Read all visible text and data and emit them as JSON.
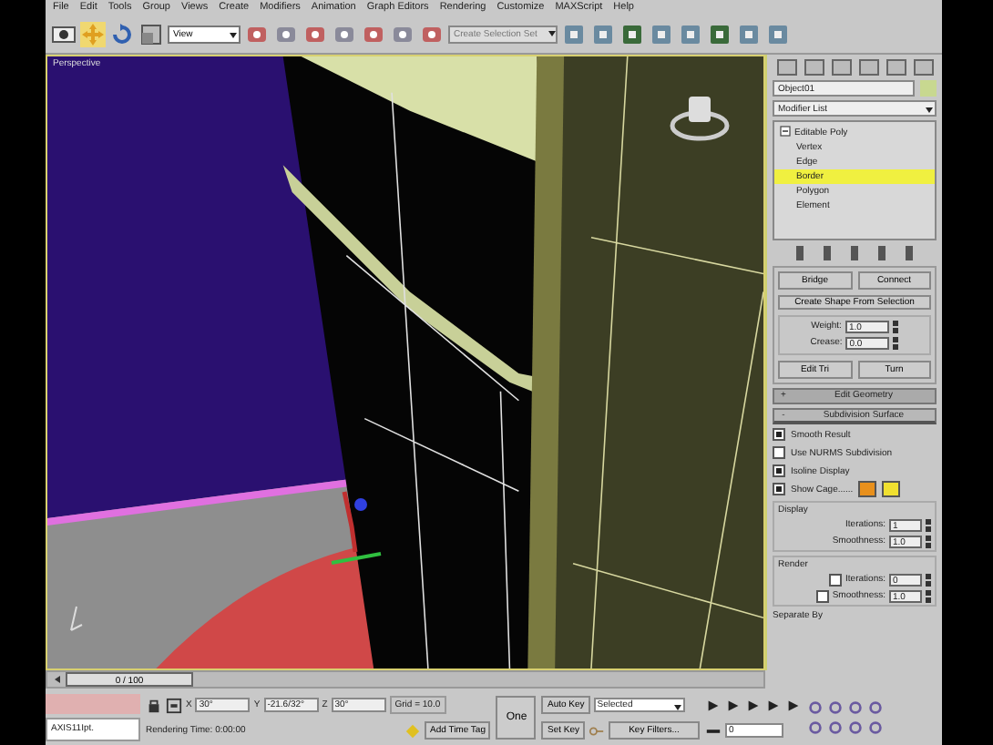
{
  "menu": [
    "File",
    "Edit",
    "Tools",
    "Group",
    "Views",
    "Create",
    "Modifiers",
    "Animation",
    "Graph Editors",
    "Rendering",
    "Customize",
    "MAXScript",
    "Help"
  ],
  "toolbar": {
    "view_dropdown": "View",
    "selection_set": {
      "placeholder": "Create Selection Set"
    }
  },
  "viewport": {
    "label": "Perspective"
  },
  "command_panel": {
    "object_name": "Object01",
    "modifier_list": "Modifier List",
    "stack": [
      {
        "label": "Editable Poly",
        "expanded": true,
        "selected": false,
        "children": [
          {
            "label": "Vertex",
            "selected": false
          },
          {
            "label": "Edge",
            "selected": false
          },
          {
            "label": "Border",
            "selected": true
          },
          {
            "label": "Polygon",
            "selected": false
          },
          {
            "label": "Element",
            "selected": false
          }
        ]
      }
    ],
    "top_buttons": [
      "Bridge",
      "Connect"
    ],
    "create_shape_button": "Create Shape From Selection",
    "spinners": [
      {
        "label": "Weight:",
        "value": "1.0"
      },
      {
        "label": "Crease:",
        "value": "0.0"
      }
    ],
    "edit_buttons": [
      "Edit Tri",
      "Turn"
    ],
    "rollouts": [
      {
        "sign": "+",
        "title": "Edit Geometry",
        "expanded": false
      },
      {
        "sign": "-",
        "title": "Subdivision Surface",
        "expanded": true
      }
    ],
    "options": [
      {
        "label": "Smooth Result",
        "checked": true
      },
      {
        "label": "Use NURMS Subdivision",
        "checked": false
      },
      {
        "label": "Isoline Display",
        "checked": true
      },
      {
        "label": "Show Cage......",
        "checked": true
      }
    ],
    "cage_colors": [
      {
        "color": "#e8901c"
      },
      {
        "color": "#f0e030"
      }
    ],
    "display": {
      "title": "Display",
      "rows": [
        {
          "label": "Iterations:",
          "value": "1"
        },
        {
          "label": "Smoothness:",
          "value": "1.0"
        }
      ]
    },
    "render": {
      "title": "Render",
      "rows": [
        {
          "label": "Iterations:",
          "value": "0",
          "checked": false
        },
        {
          "label": "Smoothness:",
          "value": "1.0",
          "checked": false
        }
      ]
    },
    "separate_by": "Separate By"
  },
  "timeline": {
    "frame": "0 / 100",
    "level": 0
  },
  "status": {
    "script_field": "AXIS11Ipt.",
    "coords": [
      {
        "axis": "X",
        "value": "30°"
      },
      {
        "axis": "Y",
        "value": "-21.6/32°"
      },
      {
        "axis": "Z",
        "value": "30°"
      }
    ],
    "grid": "Grid = 10.0",
    "one_button": "One",
    "message": "Rendering Time: 0:00:00",
    "time_tag": "Add Time Tag",
    "auto_key": "Auto Key",
    "key_mode": "Selected",
    "set_key": "Set Key",
    "key_filters": "Key Filters...",
    "frame": "0"
  }
}
